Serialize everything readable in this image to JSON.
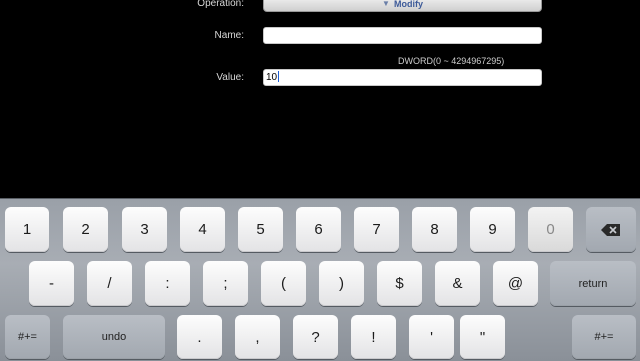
{
  "form": {
    "operation_label": "Operation:",
    "operation_value": "Modify",
    "name_label": "Name:",
    "name_value": "",
    "value_hint": "DWORD(0 ~ 4294967295)",
    "value_label": "Value:",
    "value_value": "10"
  },
  "keyboard": {
    "row1": [
      "1",
      "2",
      "3",
      "4",
      "5",
      "6",
      "7",
      "8",
      "9",
      "0"
    ],
    "delete_icon": "backspace-icon",
    "row2": [
      "-",
      "/",
      ":",
      ";",
      "(",
      ")",
      "$",
      "&",
      "@"
    ],
    "return_label": "return",
    "shift_label": "#+=",
    "undo_label": "undo",
    "row3": [
      ".",
      ",",
      "?",
      "!",
      "'",
      "\""
    ],
    "shift_right_label": "#+="
  }
}
